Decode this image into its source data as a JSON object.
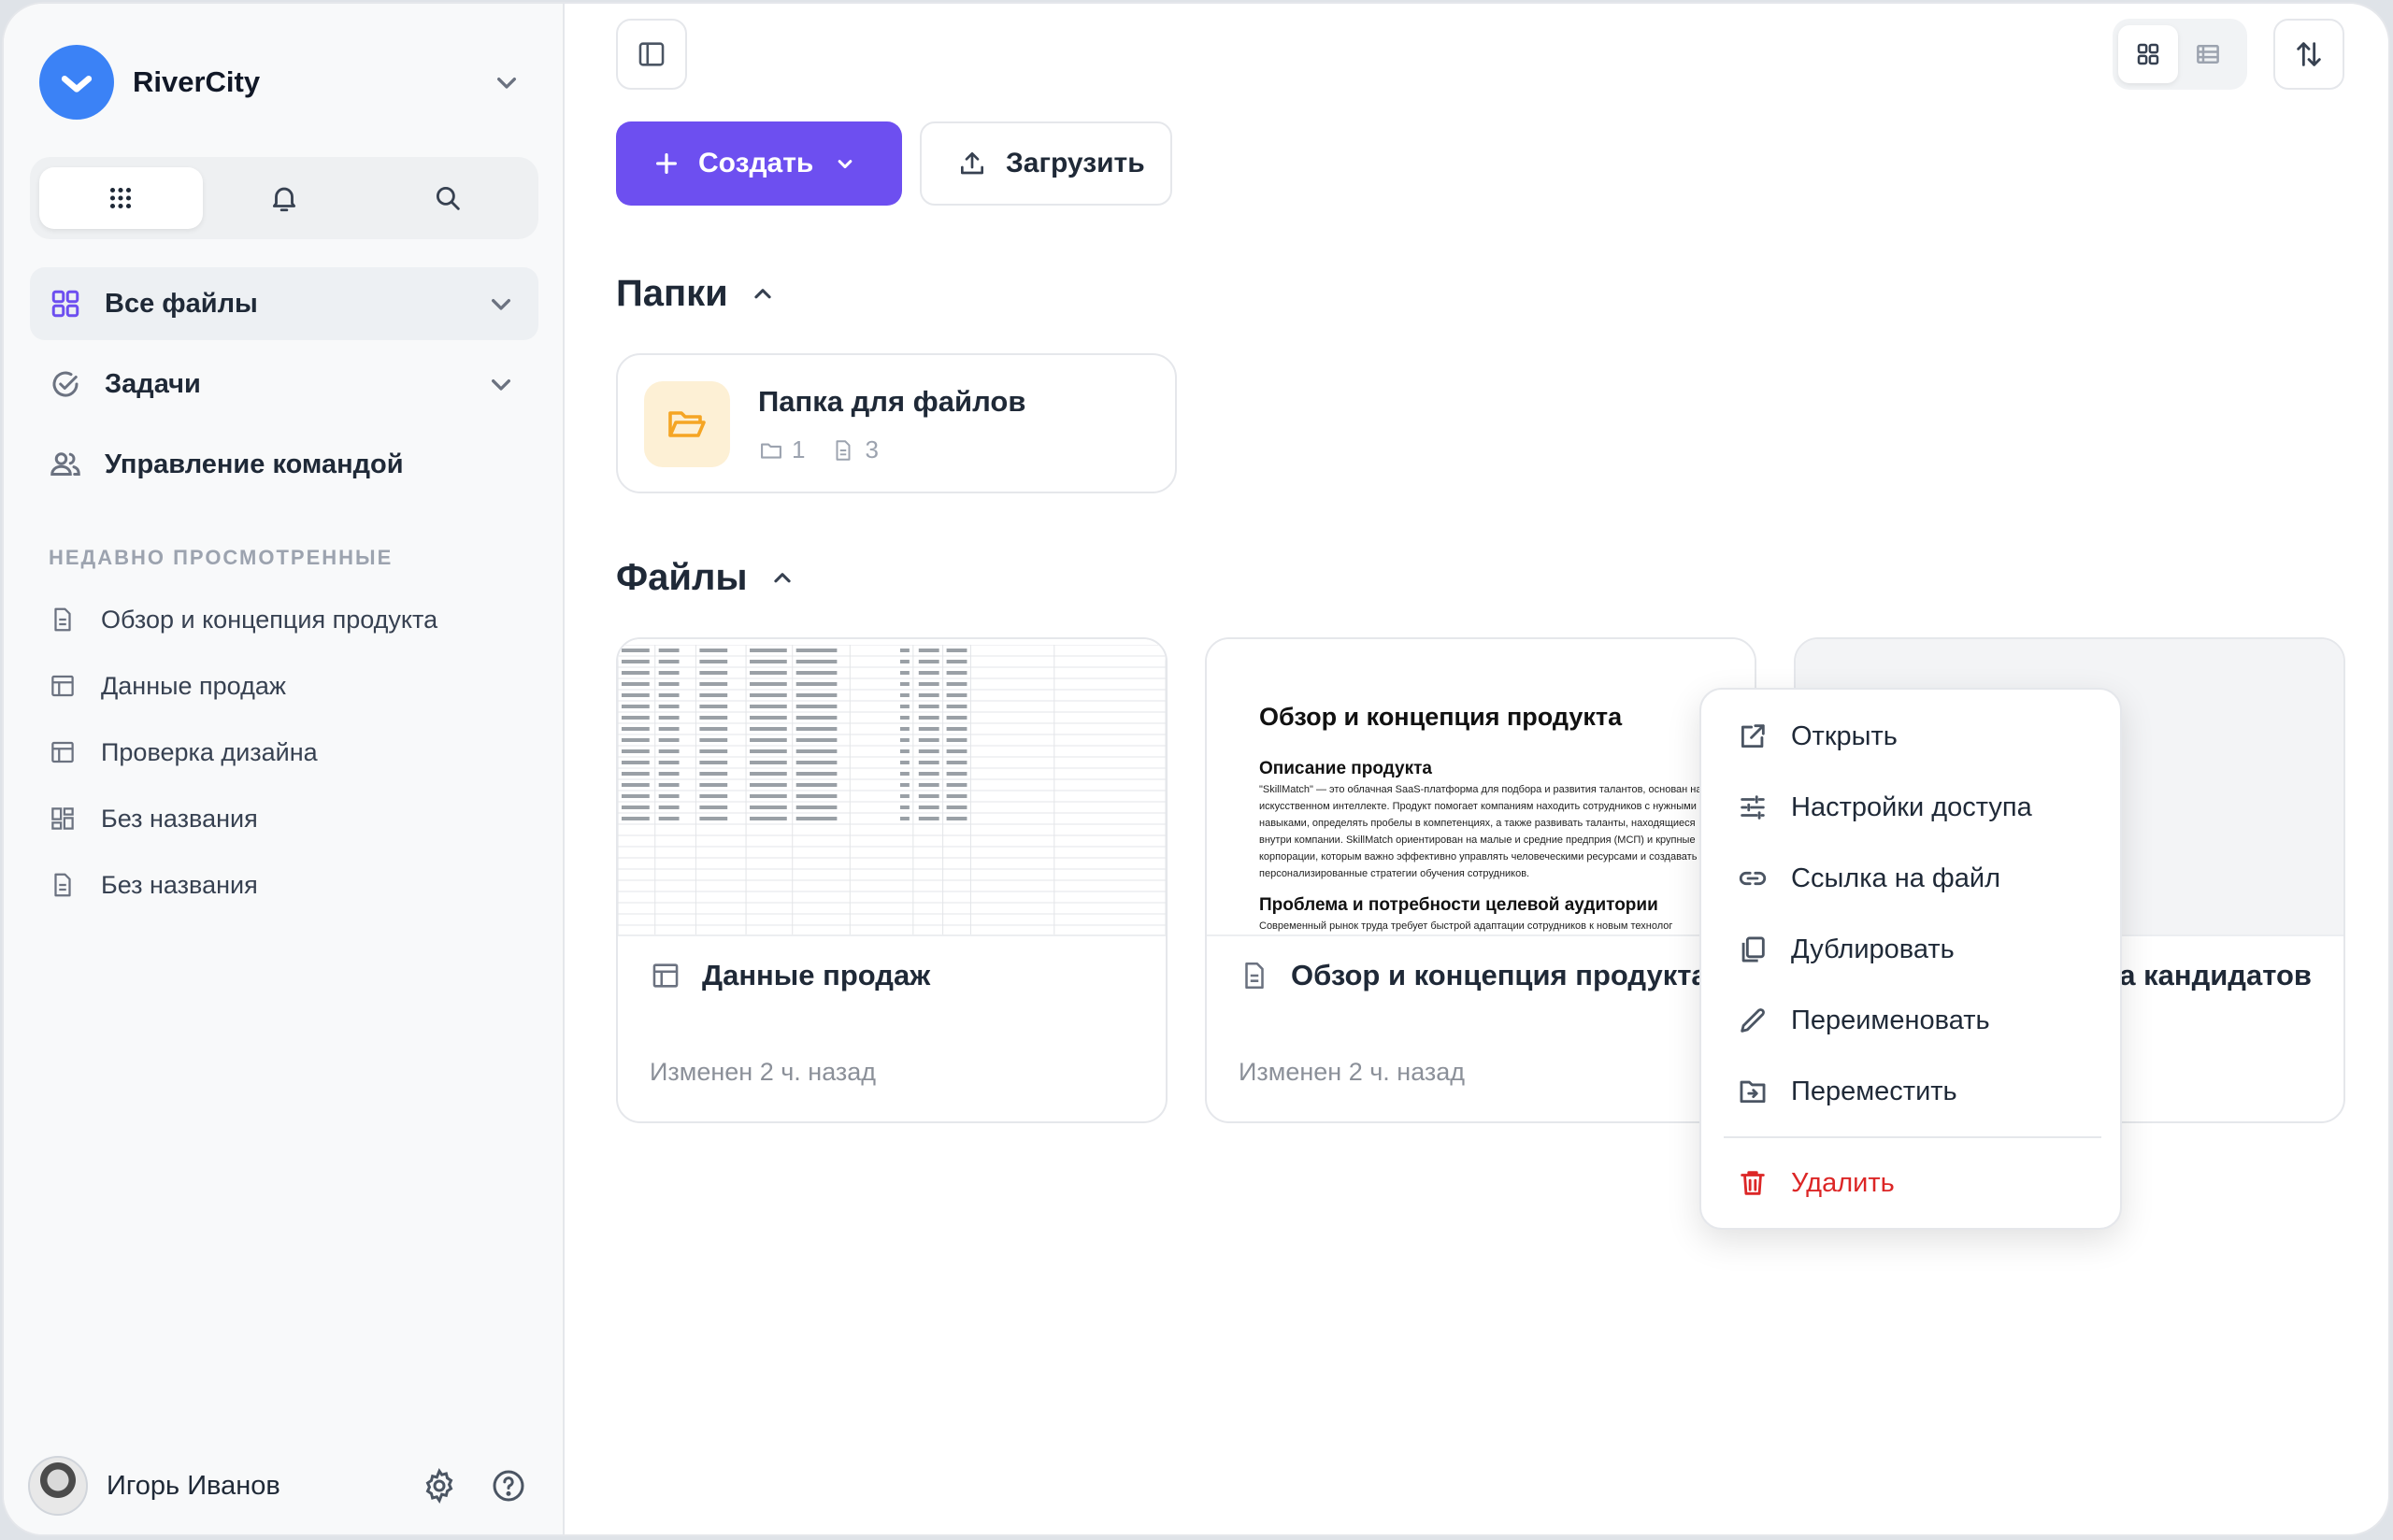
{
  "workspace": {
    "name": "RiverCity"
  },
  "sidebar": {
    "nav": [
      {
        "label": "Все файлы",
        "icon": "grid-icon"
      },
      {
        "label": "Задачи",
        "icon": "check-circle-icon"
      },
      {
        "label": "Управление командой",
        "icon": "users-icon"
      }
    ],
    "recent_title": "НЕДАВНО ПРОСМОТРЕННЫЕ",
    "recent": [
      {
        "label": "Обзор и концепция продукта",
        "icon": "document-icon"
      },
      {
        "label": "Данные продаж",
        "icon": "table-icon"
      },
      {
        "label": "Проверка дизайна",
        "icon": "table-icon"
      },
      {
        "label": "Без названия",
        "icon": "board-icon"
      },
      {
        "label": "Без названия",
        "icon": "document-icon"
      }
    ],
    "user": {
      "name": "Игорь Иванов"
    }
  },
  "toolbar": {
    "create_label": "Создать",
    "upload_label": "Загрузить"
  },
  "folders_section": {
    "title": "Папки",
    "items": [
      {
        "name": "Папка для файлов",
        "subfolders": "1",
        "files": "3"
      }
    ]
  },
  "files_section": {
    "title": "Файлы",
    "cards": [
      {
        "title": "Данные продаж",
        "meta": "Изменен 2 ч. назад",
        "icon": "table-icon"
      },
      {
        "title": "Обзор и концепция продукта",
        "meta": "Изменен 2 ч. назад",
        "icon": "document-icon"
      },
      {
        "title_visible_part": "а кандидатов"
      }
    ]
  },
  "doc_preview": {
    "title": "Обзор и концепция продукта",
    "h1": "Описание продукта",
    "p1": "\"SkillMatch\" — это облачная SaaS-платформа для подбора и развития талантов, основан на искусственном интеллекте. Продукт помогает компаниям находить сотрудников с нужными навыками, определять пробелы в компетенциях, а также развивать таланты, находящиеся внутри компании. SkillMatch ориентирован на малые и средние предприя (МСП) и крупные корпорации, которым важно эффективно управлять человеческими ресурсами и создавать персонализированные стратегии обучения сотрудников.",
    "h2": "Проблема и потребности целевой аудитории",
    "p2": "Современный рынок труда требует быстрой адаптации сотрудников к новым технолог"
  },
  "context_menu": {
    "items": [
      {
        "label": "Открыть",
        "icon": "external-link-icon"
      },
      {
        "label": "Настройки доступа",
        "icon": "sliders-icon"
      },
      {
        "label": "Ссылка на файл",
        "icon": "link-icon"
      },
      {
        "label": "Дублировать",
        "icon": "copy-icon"
      },
      {
        "label": "Переименовать",
        "icon": "pencil-icon"
      },
      {
        "label": "Переместить",
        "icon": "move-folder-icon"
      }
    ],
    "danger": {
      "label": "Удалить",
      "icon": "trash-icon"
    }
  },
  "colors": {
    "accent": "#6d4ff0",
    "brand": "#3b82f6",
    "danger": "#dc2626",
    "folder": "#f5b942"
  }
}
